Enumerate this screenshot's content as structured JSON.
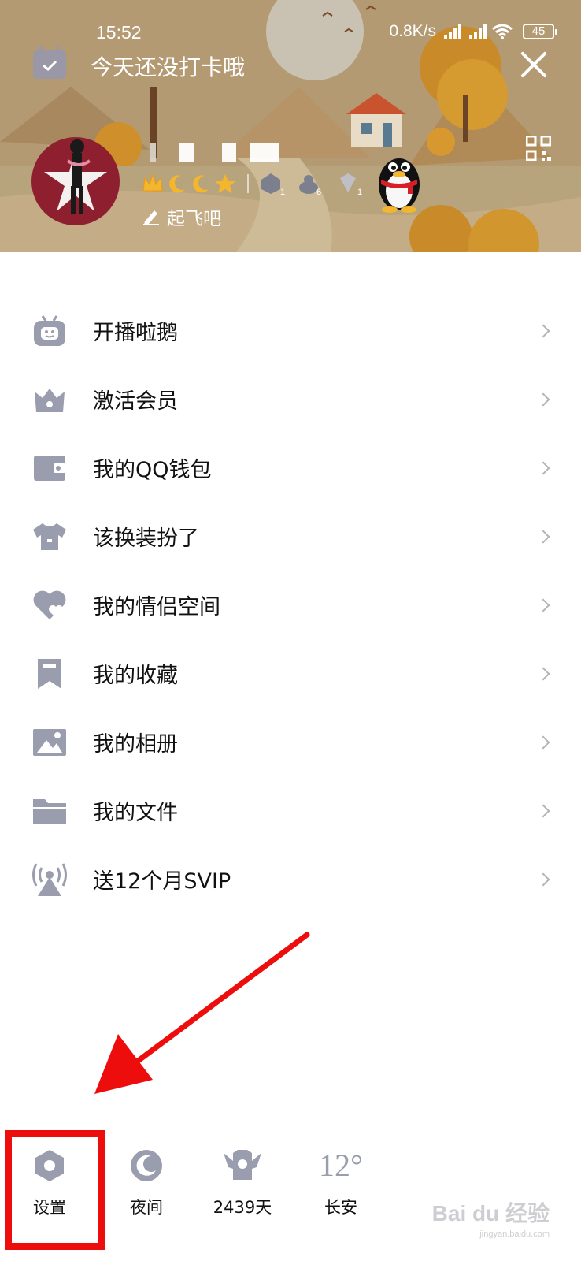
{
  "status_bar": {
    "time": "15:52",
    "network_speed": "0.8K/s",
    "battery": "45",
    "icons": [
      "hd-signal-icon",
      "hd-signal-icon",
      "wifi-icon",
      "battery-icon"
    ]
  },
  "header": {
    "checkin_text": "今天还没打卡哦",
    "signature": "起飞吧",
    "badges": [
      "crown-icon",
      "moon-icon",
      "moon-icon",
      "star-icon"
    ],
    "medals": [
      {
        "icon": "medal-icon",
        "count": "1"
      },
      {
        "icon": "medal-icon",
        "count": "6"
      },
      {
        "icon": "medal-icon",
        "count": "1"
      }
    ]
  },
  "menu": {
    "items": [
      {
        "icon": "tv-robot-icon",
        "label": "开播啦鹅"
      },
      {
        "icon": "crown-icon",
        "label": "激活会员"
      },
      {
        "icon": "wallet-icon",
        "label": "我的QQ钱包"
      },
      {
        "icon": "shirt-icon",
        "label": "该换装扮了"
      },
      {
        "icon": "heart-icon",
        "label": "我的情侣空间"
      },
      {
        "icon": "bookmark-icon",
        "label": "我的收藏"
      },
      {
        "icon": "image-icon",
        "label": "我的相册"
      },
      {
        "icon": "folder-icon",
        "label": "我的文件"
      },
      {
        "icon": "antenna-icon",
        "label": "送12个月SVIP"
      }
    ]
  },
  "bottom_bar": {
    "settings_label": "设置",
    "night_label": "夜间",
    "days_label": "2439天",
    "temperature": "12°",
    "city_label": "长安"
  },
  "watermark": {
    "text": "Bai du 经验",
    "url": "jingyan.baidu.com"
  },
  "colors": {
    "icon_gray": "#9a9dae",
    "highlight_red": "#ee0d0d",
    "banner": "#b59a72"
  }
}
